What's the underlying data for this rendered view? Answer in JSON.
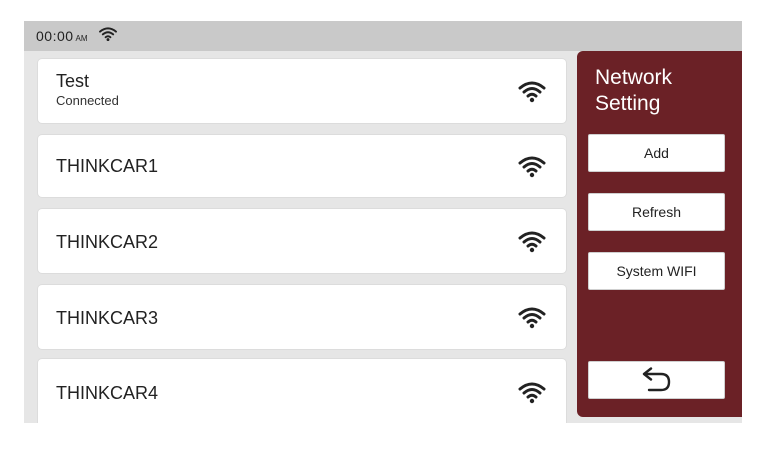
{
  "status_bar": {
    "time": "00:00",
    "ampm": "AM",
    "wifi_icon": "wifi-icon"
  },
  "networks": [
    {
      "name": "Test",
      "status": "Connected",
      "signal_icon": "wifi-signal-icon"
    },
    {
      "name": "THINKCAR1",
      "signal_icon": "wifi-signal-icon"
    },
    {
      "name": "THINKCAR2",
      "signal_icon": "wifi-signal-icon"
    },
    {
      "name": "THINKCAR3",
      "signal_icon": "wifi-signal-icon"
    },
    {
      "name": "THINKCAR4",
      "signal_icon": "wifi-signal-icon"
    }
  ],
  "side_panel": {
    "title": "Network Setting",
    "buttons": {
      "add": "Add",
      "refresh": "Refresh",
      "system_wifi": "System WIFI",
      "back_icon": "back-arrow-icon"
    }
  },
  "colors": {
    "panel": "#6b2126",
    "status_bar": "#c9c9c9",
    "background": "#e6e6e6"
  }
}
